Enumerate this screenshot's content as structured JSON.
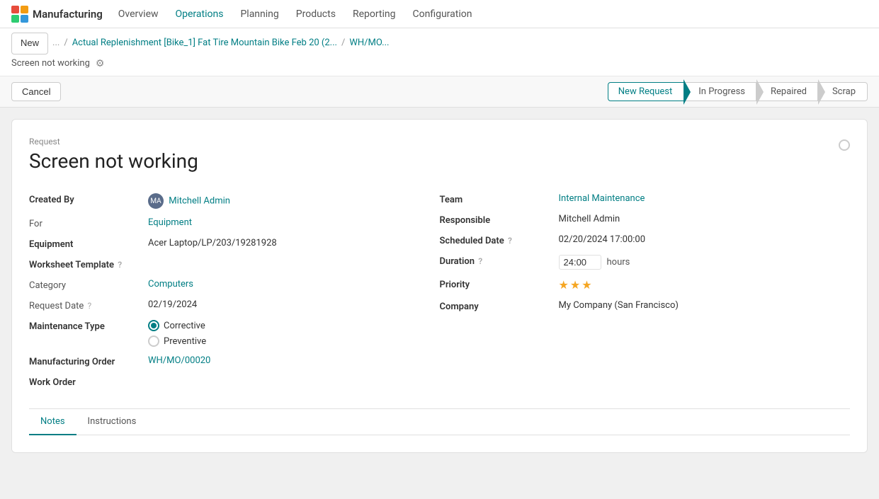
{
  "app": {
    "logo_text": "Manufacturing",
    "nav_items": [
      "Overview",
      "Operations",
      "Planning",
      "Products",
      "Reporting",
      "Configuration"
    ]
  },
  "breadcrumb": {
    "new_btn": "New",
    "dots": "...",
    "crumb1": "Actual Replenishment [Bike_1] Fat Tire Mountain Bike Feb 20 (2...",
    "crumb2": "WH/MO...",
    "current": "Screen not working",
    "gear_symbol": "⚙"
  },
  "toolbar": {
    "cancel_label": "Cancel"
  },
  "status_steps": [
    {
      "label": "New Request",
      "active": true
    },
    {
      "label": "In Progress",
      "active": false
    },
    {
      "label": "Repaired",
      "active": false
    },
    {
      "label": "Scrap",
      "active": false
    }
  ],
  "form": {
    "request_label": "Request",
    "title": "Screen not working",
    "left": {
      "created_by_label": "Created By",
      "created_by_value": "Mitchell Admin",
      "for_label": "For",
      "for_value": "Equipment",
      "equipment_label": "Equipment",
      "equipment_value": "Acer Laptop/LP/203/19281928",
      "worksheet_label": "Worksheet Template",
      "worksheet_hint": "?",
      "category_label": "Category",
      "category_value": "Computers",
      "request_date_label": "Request Date",
      "request_date_hint": "?",
      "request_date_value": "02/19/2024",
      "maintenance_type_label": "Maintenance Type",
      "corrective_label": "Corrective",
      "preventive_label": "Preventive",
      "manufacturing_order_label": "Manufacturing Order",
      "manufacturing_order_value": "WH/MO/00020",
      "work_order_label": "Work Order"
    },
    "right": {
      "team_label": "Team",
      "team_value": "Internal Maintenance",
      "responsible_label": "Responsible",
      "responsible_value": "Mitchell Admin",
      "scheduled_date_label": "Scheduled Date",
      "scheduled_date_hint": "?",
      "scheduled_date_value": "02/20/2024 17:00:00",
      "duration_label": "Duration",
      "duration_hint": "?",
      "duration_value": "24:00",
      "duration_unit": "hours",
      "priority_label": "Priority",
      "priority_stars": "★★★",
      "company_label": "Company",
      "company_value": "My Company (San Francisco)"
    }
  },
  "tabs": [
    {
      "label": "Notes",
      "active": true
    },
    {
      "label": "Instructions",
      "active": false
    }
  ]
}
